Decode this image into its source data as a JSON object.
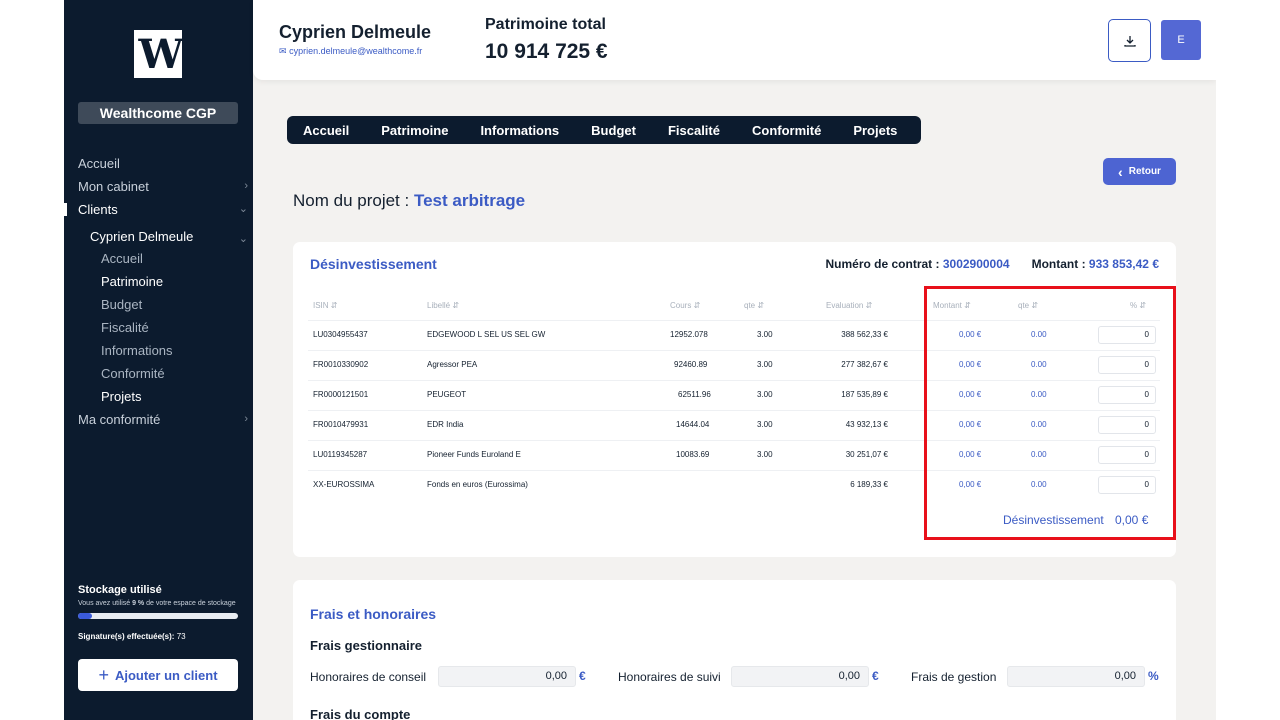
{
  "sidebar": {
    "org": "Wealthcome CGP",
    "nav": [
      {
        "label": "Accueil"
      },
      {
        "label": "Mon cabinet"
      },
      {
        "label": "Clients"
      },
      {
        "label": "Cyprien Delmeule"
      },
      {
        "label": "Accueil"
      },
      {
        "label": "Patrimoine"
      },
      {
        "label": "Budget"
      },
      {
        "label": "Fiscalité"
      },
      {
        "label": "Informations"
      },
      {
        "label": "Conformité"
      },
      {
        "label": "Projets"
      },
      {
        "label": "Ma conformité"
      }
    ],
    "storage": {
      "title": "Stockage utilisé",
      "subtitle_prefix": "Vous avez utilisé ",
      "percent_text": "9 %",
      "subtitle_suffix": " de votre espace de stockage",
      "percent": 9,
      "signatures_label": "Signature(s) effectuée(s):",
      "signatures_count": "73"
    },
    "add_client": "Ajouter un client"
  },
  "header": {
    "client_name": "Cyprien Delmeule",
    "client_email": "cyprien.delmeule@wealthcome.fr",
    "patrimoine_label": "Patrimoine total",
    "patrimoine_value": "10 914 725 €",
    "user_initial": "E"
  },
  "tabs": [
    "Accueil",
    "Patrimoine",
    "Informations",
    "Budget",
    "Fiscalité",
    "Conformité",
    "Projets"
  ],
  "retour": "Retour",
  "project": {
    "label": "Nom du projet : ",
    "name": "Test arbitrage"
  },
  "desinvestissement": {
    "title": "Désinvestissement",
    "contract_label": "Numéro de contrat : ",
    "contract_number": "3002900004",
    "montant_label": "Montant : ",
    "montant_value": "933 853,42 €",
    "headers": [
      "ISIN",
      "Libellé",
      "Cours",
      "qte",
      "Evaluation",
      "Montant",
      "qte",
      "%"
    ],
    "rows": [
      {
        "isin": "LU0304955437",
        "libelle": "EDGEWOOD L SEL US SEL GW",
        "cours": "12952.078",
        "qte": "3.00",
        "evaluation": "388 562,33 €",
        "montant": "0,00 €",
        "qte2": "0.00",
        "pct": "0"
      },
      {
        "isin": "FR0010330902",
        "libelle": "Agressor PEA",
        "cours": "92460.89",
        "qte": "3.00",
        "evaluation": "277 382,67 €",
        "montant": "0,00 €",
        "qte2": "0.00",
        "pct": "0"
      },
      {
        "isin": "FR0000121501",
        "libelle": "PEUGEOT",
        "cours": "62511.96",
        "qte": "3.00",
        "evaluation": "187 535,89 €",
        "montant": "0,00 €",
        "qte2": "0.00",
        "pct": "0"
      },
      {
        "isin": "FR0010479931",
        "libelle": "EDR India",
        "cours": "14644.04",
        "qte": "3.00",
        "evaluation": "43 932,13 €",
        "montant": "0,00 €",
        "qte2": "0.00",
        "pct": "0"
      },
      {
        "isin": "LU0119345287",
        "libelle": "Pioneer Funds Euroland E",
        "cours": "10083.69",
        "qte": "3.00",
        "evaluation": "30 251,07 €",
        "montant": "0,00 €",
        "qte2": "0.00",
        "pct": "0"
      },
      {
        "isin": "XX-EUROSSIMA",
        "libelle": "Fonds en euros (Eurossima)",
        "cours": "",
        "qte": "",
        "evaluation": "6 189,33 €",
        "montant": "0,00 €",
        "qte2": "0.00",
        "pct": "0"
      }
    ],
    "total_label": "Désinvestissement",
    "total_value": "0,00 €"
  },
  "frais": {
    "title": "Frais et honoraires",
    "gestionnaire_title": "Frais gestionnaire",
    "fields": [
      {
        "label": "Honoraires de conseil",
        "value": "0,00",
        "unit": "€"
      },
      {
        "label": "Honoraires de suivi",
        "value": "0,00",
        "unit": "€"
      },
      {
        "label": "Frais de gestion",
        "value": "0,00",
        "unit": "%"
      }
    ],
    "compte_title": "Frais du compte"
  },
  "colors": {
    "sidebar_bg": "#0c1b2e",
    "accent": "#3b5bc4",
    "highlight": "#e8101a"
  }
}
